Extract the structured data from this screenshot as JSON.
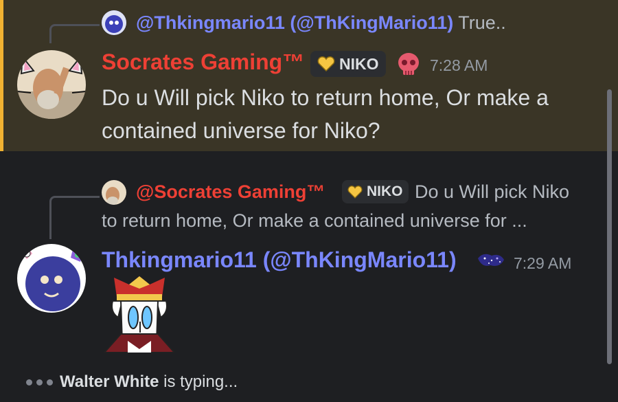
{
  "message1": {
    "reply": {
      "name": "@Thkingmario11 (@ThKingMario11)",
      "preview": "True.."
    },
    "username": "Socrates Gaming™",
    "badge": "NIKO",
    "time": "7:28 AM",
    "lines": [
      "Do u Will pick Niko to return home, Or make a",
      "contained universe for Niko?"
    ]
  },
  "message2": {
    "reply": {
      "name": "@Socrates Gaming™",
      "badge": "NIKO",
      "preview_line1": "Do u Will pick Niko",
      "preview_line2": "to return home, Or make a contained universe for ..."
    },
    "username": "Thkingmario11 (@ThKingMario11)",
    "time": "7:29 AM"
  },
  "typing": {
    "user": "Walter White",
    "text": "is typing..."
  },
  "icons": [
    "reply-avatar-icon",
    "heart-badge-icon",
    "skull-role-icon",
    "galaxy-role-icon",
    "typing-dots-icon"
  ],
  "colors": {
    "background": "#1e1f22",
    "highlight": "#3a3526",
    "highlight_bar": "#f0b232",
    "name_blue": "#7a87ff",
    "name_red": "#ee4035",
    "timestamp": "#949ba4"
  }
}
